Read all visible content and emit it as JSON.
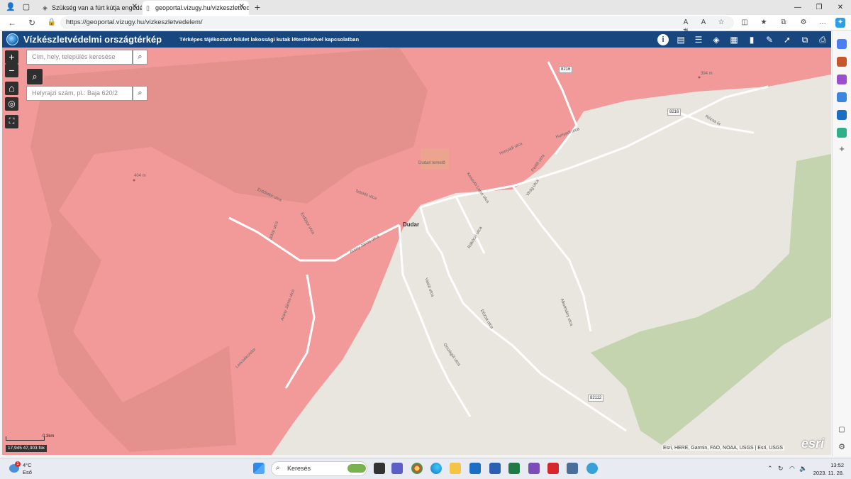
{
  "browser": {
    "tabs": [
      {
        "title": "Szükség van a fúrt kútja engedélyeztetésére?",
        "active": false
      },
      {
        "title": "geoportal.vizugy.hu/vizkeszletvedelem/",
        "active": true
      }
    ],
    "new_tab": "+",
    "url": "https://geoportal.vizugy.hu/vizkeszletvedelem/"
  },
  "app": {
    "title": "Vízkészletvédelmi országtérkép",
    "subtitle": "Térképes tájékoztató felület lakossági kutak létesítésével kapcsolatban",
    "toolbar_icons": [
      "info-icon",
      "legend-icon",
      "list-icon",
      "layers-icon",
      "grid-icon",
      "measure-icon",
      "draw-icon",
      "share-icon",
      "compare-icon",
      "print-icon"
    ]
  },
  "map": {
    "zoom_in": "+",
    "zoom_out": "−",
    "search_place_placeholder": "Cím, hely, település keresése",
    "search_parcel_placeholder": "Helyrajzi szám, pl.: Baja 620/2",
    "place_label": "Dudar",
    "poi_label": "Dudari temető",
    "elevation_labels": [
      "404 m",
      "394 m"
    ],
    "road_shields": [
      "8216",
      "8216",
      "82112"
    ],
    "streets": [
      "Erdőtelor utca",
      "Jókai utca",
      "Erdősor utca",
      "Telekló utca",
      "Arany János utca",
      "Arany János utca",
      "Vasút utca",
      "Rákóczi utca",
      "Kossuth Lajos utca",
      "Hunyadi utca",
      "Hunyadi utca",
      "Petőfi utca",
      "Virág utca",
      "Dózsa utca",
      "Alkotmány utca",
      "Országút utca",
      "Rózsa út",
      "Lencsékondor"
    ],
    "scale_label": "0.3km",
    "coordinates": "17,945 47,303 fok",
    "attribution": "Esri, HERE, Garmin, FAO, NOAA, USGS | Esri, USGS",
    "esri_logo": "esri",
    "colors": {
      "restricted_zone": "#f29a9a",
      "forest": "#b9cfa3",
      "base": "#e9e6df"
    }
  },
  "taskbar": {
    "weather_temp": "4°C",
    "weather_desc": "Eső",
    "weather_badge": "1",
    "search_label": "Keresés",
    "time": "13:52",
    "date": "2023. 11. 28."
  }
}
